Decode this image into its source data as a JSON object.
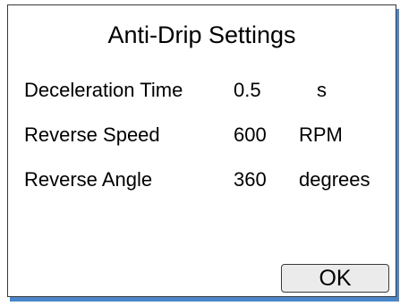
{
  "dialog": {
    "title": "Anti-Drip Settings",
    "settings": [
      {
        "label": "Deceleration Time",
        "value": "0.5",
        "unit": "s"
      },
      {
        "label": "Reverse Speed",
        "value": "600",
        "unit": "RPM"
      },
      {
        "label": "Reverse Angle",
        "value": "360",
        "unit": "degrees"
      }
    ],
    "ok_label": "OK"
  },
  "colors": {
    "border": "#3a3a3a",
    "shadow": "#4a86c8",
    "button_face": "#ebebeb"
  }
}
